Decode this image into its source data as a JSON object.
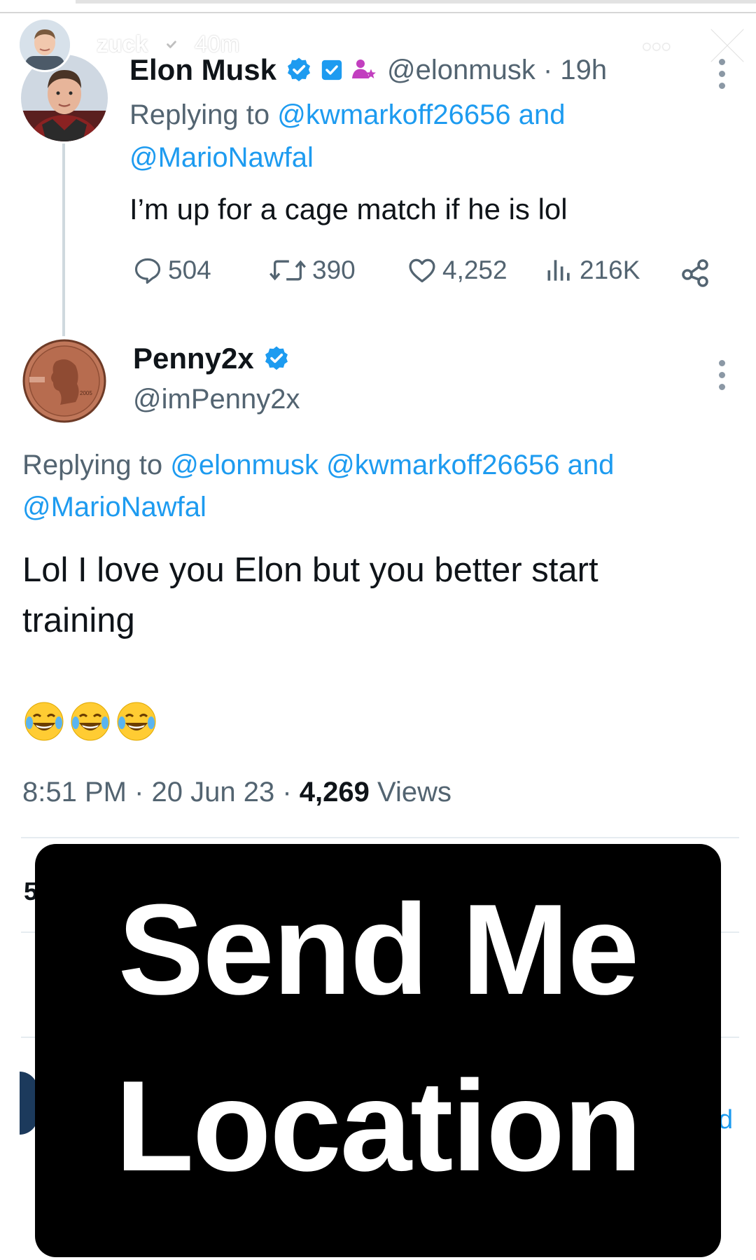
{
  "story": {
    "username": "zuck",
    "time": "40m",
    "more_label": "•••",
    "progress": 0.1
  },
  "tweet1": {
    "name": "Elon Musk",
    "handle_time": "@elonmusk · 19h",
    "replying_prefix": "Replying to",
    "replying_to_1": "@kwmarkoff26656",
    "replying_and": "and",
    "replying_to_2": "@MarioNawfal",
    "text": "I’m up for a cage match if he is lol",
    "replies": "504",
    "retweets": "390",
    "likes": "4,252",
    "views": "216K"
  },
  "tweet2": {
    "name": "Penny2x",
    "handle": "@imPenny2x",
    "replying_prefix": "Replying to",
    "replying_to_1": "@elonmusk",
    "replying_to_2": "@kwmarkoff26656",
    "replying_and": "and",
    "replying_to_3": "@MarioNawfal",
    "text_line1": "Lol I love you Elon but you better start",
    "text_line2": "training",
    "emojis": "😂😂😂",
    "time": "8:51 PM",
    "date": "20 Jun 23",
    "views_count": "4,269",
    "views_label": "Views",
    "partial_stat": "5"
  },
  "overlay": {
    "line1": "Send Me",
    "line2": "Location"
  },
  "colors": {
    "link": "#1d9bf0",
    "verified": "#1d9bf0",
    "muted": "#536471",
    "overlay_bg": "#000000"
  },
  "icons": [
    "verified-badge-icon",
    "close-icon",
    "more-icon",
    "reply-icon",
    "retweet-icon",
    "like-icon",
    "views-icon",
    "share-icon"
  ]
}
